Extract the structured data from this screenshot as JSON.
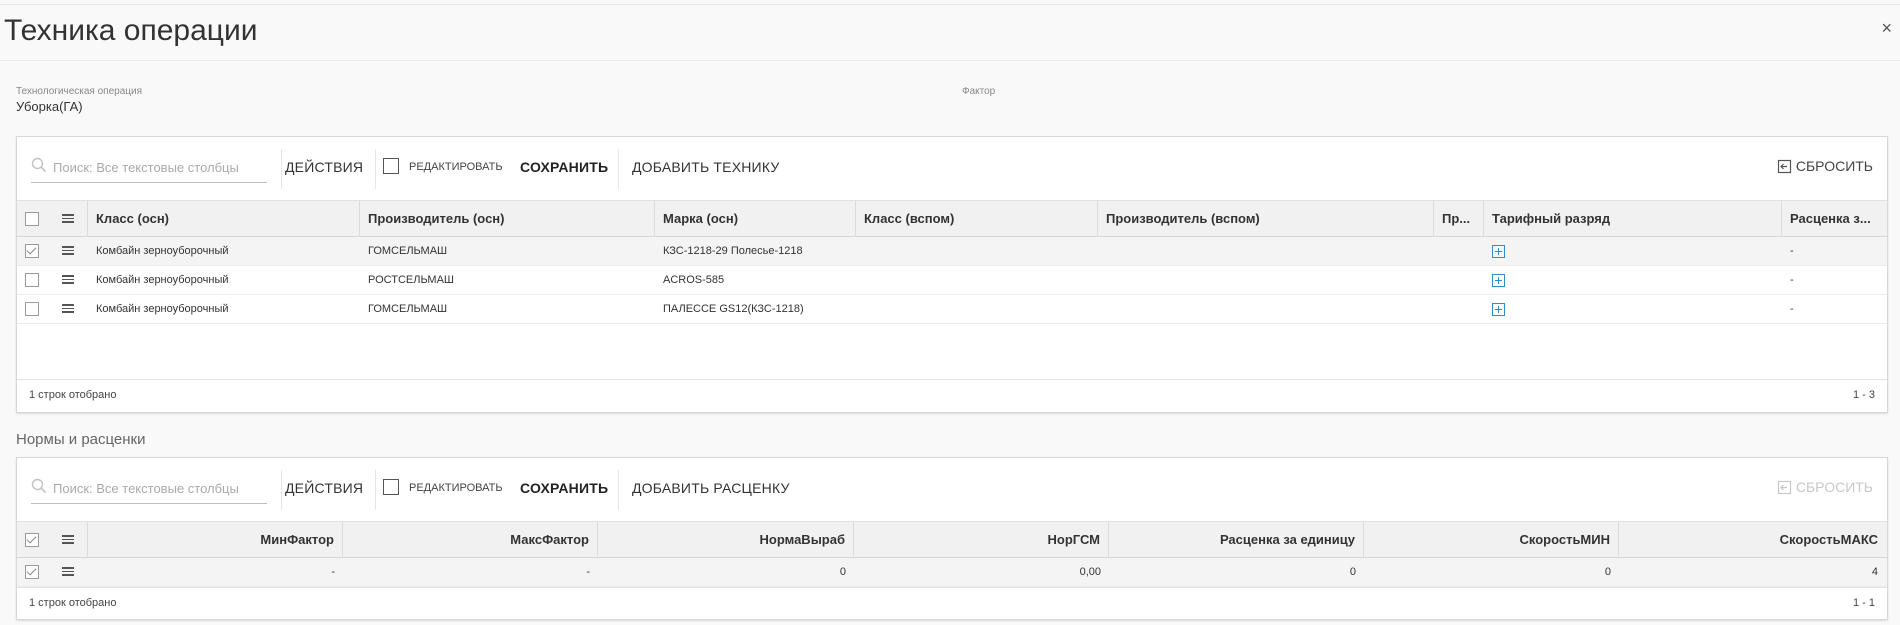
{
  "dialog": {
    "title": "Техника операции",
    "close_glyph": "×"
  },
  "fields": {
    "operation_label": "Технологическая операция",
    "operation_value": "Уборка(ГА)",
    "factor_label": "Фактор",
    "factor_value": ""
  },
  "equipment": {
    "toolbar": {
      "search_placeholder": "Поиск: Все текстовые столбцы",
      "actions_label": "ДЕЙСТВИЯ",
      "edit_label": "РЕДАКТИРОВАТЬ",
      "save_label": "СОХРАНИТЬ",
      "add_label": "ДОБАВИТЬ ТЕХНИКУ",
      "reset_label": "СБРОСИТЬ"
    },
    "columns": [
      "Класс (осн)",
      "Производитель (осн)",
      "Марка (осн)",
      "Класс (вспом)",
      "Производитель (вспом)",
      "Пр...",
      "Тарифный разряд",
      "Расценка з..."
    ],
    "rows": [
      {
        "selected": true,
        "class": "Комбайн зерноуборочный",
        "manufacturer": "ГОМСЕЛЬМАШ",
        "brand": "КЗС-1218-29 Полесье-1218",
        "class_aux": "",
        "manufacturer_aux": "",
        "pr": "",
        "rate": "-"
      },
      {
        "selected": false,
        "class": "Комбайн зерноуборочный",
        "manufacturer": "РОСТСЕЛЬМАШ",
        "brand": "ACROS-585",
        "class_aux": "",
        "manufacturer_aux": "",
        "pr": "",
        "rate": "-"
      },
      {
        "selected": false,
        "class": "Комбайн зерноуборочный",
        "manufacturer": "ГОМСЕЛЬМАШ",
        "brand": "ПАЛЕССЕ GS12(КЗС-1218)",
        "class_aux": "",
        "manufacturer_aux": "",
        "pr": "",
        "rate": "-"
      }
    ],
    "footer_left": "1 строк отобрано",
    "footer_right": "1 - 3"
  },
  "norms": {
    "section_title": "Нормы и расценки",
    "toolbar": {
      "search_placeholder": "Поиск: Все текстовые столбцы",
      "actions_label": "ДЕЙСТВИЯ",
      "edit_label": "РЕДАКТИРОВАТЬ",
      "save_label": "СОХРАНИТЬ",
      "add_label": "ДОБАВИТЬ РАСЦЕНКУ",
      "reset_label": "СБРОСИТЬ"
    },
    "columns": [
      "МинФактор",
      "МаксФактор",
      "НормаВыраб",
      "НорГСМ",
      "Расценка за единицу",
      "СкоростьМИН",
      "СкоростьМАКС"
    ],
    "rows": [
      {
        "selected": true,
        "min_factor": "-",
        "max_factor": "-",
        "norm": "0",
        "gsm": "0,00",
        "price": "0",
        "speed_min": "0",
        "speed_max": "4"
      }
    ],
    "footer_left": "1 строк отобрано",
    "footer_right": "1 - 1"
  },
  "colors": {
    "accent": "#2d8fd0",
    "border": "#d8d8d8",
    "header_bg": "#f1f1f1"
  },
  "icons": [
    "search-icon",
    "menu-icon",
    "checkbox-icon",
    "plus-square-icon",
    "reset-icon",
    "close-icon"
  ]
}
